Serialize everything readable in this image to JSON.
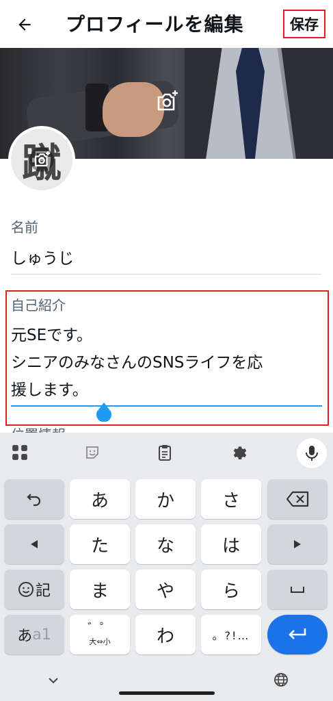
{
  "header": {
    "title": "プロフィールを編集",
    "save_label": "保存"
  },
  "profile": {
    "avatar_glyph": "蹴"
  },
  "fields": {
    "name_label": "名前",
    "name_value": "しゅうじ",
    "bio_label": "自己紹介",
    "bio_lines": [
      "元SEです。",
      "シニアのみなさんのSNSライフを応",
      "援します。"
    ],
    "location_label": "位置情報"
  },
  "keyboard": {
    "row1": [
      "あ",
      "か",
      "さ"
    ],
    "row2": [
      "た",
      "な",
      "は"
    ],
    "row3": [
      "ま",
      "や",
      "ら"
    ],
    "row4": [
      "わ"
    ],
    "kigou_label": "記",
    "mode_label_a": "あ",
    "mode_label_b": "a1",
    "dakuten_top": "゛゜",
    "dakuten_bottom": "大⇔小",
    "punct_label": "。?!…"
  },
  "colors": {
    "accent": "#1d9bf0",
    "highlight_box": "#e02020",
    "enter_key": "#1a73e8",
    "keyboard_bg": "#e8eaed"
  }
}
